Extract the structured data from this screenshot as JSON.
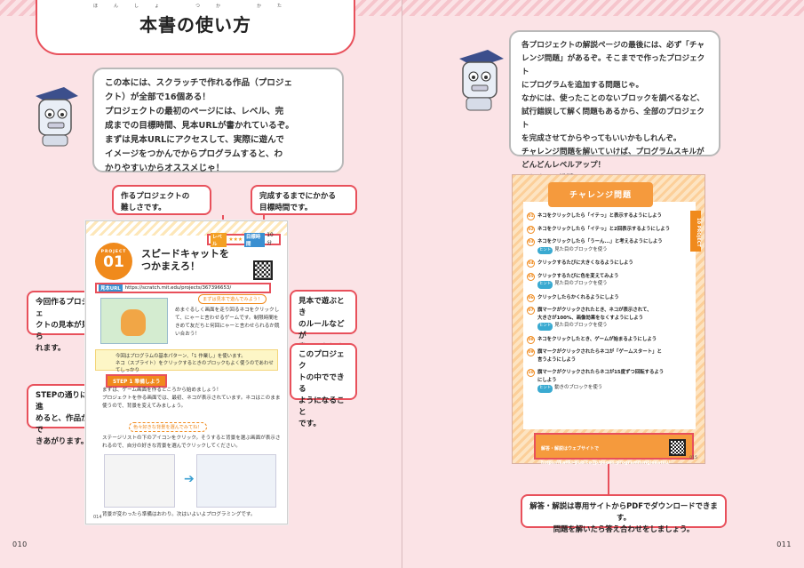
{
  "left_page": {
    "title": "本書の使い方",
    "title_ruby": "ほんしょ　つか　かた",
    "intro_bubble": "この本には、スクラッチで作れる作品（プロジェ\nクト）が全部で16個ある！\nプロジェクトの最初のページには、レベル、完\n成までの目標時間、見本URLが書かれているぞ。\nまずは見本URLにアクセスして、実際に遊んで\nイメージをつかんでからプログラムすると、わ\nかりやすいからオススメじゃ！",
    "callout_difficulty": "作るプロジェクトの\n難しさです。",
    "callout_time": "完成するまでにかかる\n目標時間です。",
    "callout_sample": "今回作るプロジェ\nクトの見本が見ら\nれます。",
    "callout_rules": "見本で遊ぶとき\nのルールなどが\n書いてあります。",
    "callout_inside": "このプロジェク\nトの中でできる\nようになること\nです。",
    "callout_steps": "STEPの通りに進\nめると、作品がで\nきあがります。",
    "page_number": "010",
    "sample": {
      "level_label": "レベル",
      "level_stars": "★★★",
      "time_label": "目標時間",
      "time_value": "10分",
      "project_label": "PROJECT",
      "project_number": "01",
      "project_title": "スピードキャットを\nつかまえろ！",
      "url_label": "見本URL",
      "url": "https://scratch.mit.edu/projects/367396653/",
      "play_pill": "まずは見本で遊んでみよう！",
      "play_text": "めまぐるしく画面を走り回るネコをクリックし\nて、にゃーと言わせるゲームです。制限時間を\nきめて友だちと何回にゃーと言わせられるか競\nい合おう！",
      "note_text": "今回はプログラムの基本パターン、「1 作業し」を使います。\nネコ（スプライト）をクリックするときのブロックもよく使うのであわせてしっかり\n覚えましょう。",
      "step_label": "STEP 1  準備しよう",
      "step_text": "まずは、ゲーム画面を作るところから始めましょう！\nプロジェクトを作る画面では、最初、ネコが表示されています。ネコはこのまま\n使うので、背景を変えてみましょう。",
      "tip_text": "色々好きな背景を選んでみてね！",
      "stage_text": "ステージリストの下のアイコンをクリック。そうすると背景を選ぶ画面が表示さ\nれるので、自分の好きな背景を選んでクリックしてください。",
      "after_text": "背景が変わったら準備はおわり。次はいよいよプログラミングです。",
      "page_number": "014"
    }
  },
  "right_page": {
    "intro_bubble": "各プロジェクトの解説ページの最後には、必ず「チャ\nレンジ問題」があるぞ。そこまでで作ったプロジェクト\nにプログラムを追加する問題じゃ。\nなかには、使ったことのないブロックを調べるなど、\n試行錯誤して解く問題もあるから、全部のプロジェクト\nを完成させてからやってもいいかもしれんぞ。\nチャレンジ問題を解いていけば、プログラムスキルが\nどんどんレベルアップ！\nはりきって挑戦していくのじゃ！",
    "challenge": {
      "banner": "チャレンジ問題",
      "side_tab": "10 PROJECT",
      "items": [
        {
          "num": "01",
          "text": "ネコをクリックしたら「イテっ」と表示するようにしよう",
          "hint": ""
        },
        {
          "num": "02",
          "text": "ネコをクリックしたら「イテっ」と2回表示するようにしよう",
          "hint": ""
        },
        {
          "num": "03",
          "text": "ネコをクリックしたら「うーん...」と考えるようにしよう",
          "hint": "見た目のブロックを使う"
        },
        {
          "num": "04",
          "text": "クリックするたびに大きくなるようにしよう",
          "hint": ""
        },
        {
          "num": "05",
          "text": "クリックするたびに色を変えてみよう",
          "hint": "見た目のブロックを使う"
        },
        {
          "num": "06",
          "text": "クリックしたらかくれるようにしよう",
          "hint": ""
        },
        {
          "num": "07",
          "text": "旗マークがクリックされたとき、ネコが表示されて、\n大きさが100%、画像効果をなくすようにしよう",
          "hint": "見た目のブロックを使う"
        },
        {
          "num": "08",
          "text": "ネコをクリックしたとき、ゲームが始まるようにしよう",
          "hint": ""
        },
        {
          "num": "09",
          "text": "旗マークがクリックされたらネコが「ゲームスタート」と\n言うようにしよう",
          "hint": ""
        },
        {
          "num": "10",
          "text": "旗マークがクリックされたらネコが15度ずつ回転するよう\nにしよう",
          "hint": "動きのブロックを使う"
        }
      ],
      "answer_label": "解答・解説はウェブサイトで",
      "answer_url": "https://kanki-pub.co.jp/pages/programmingisaatsu/",
      "page_number": "015"
    },
    "callout_download": "解答・解説は専用サイトからPDFでダウンロードできます。\n問題を解いたら答え合わせをしましょう。",
    "page_number": "011"
  },
  "colors": {
    "accent_red": "#e8505b",
    "orange": "#f08a1c",
    "page_pink": "#fbe3e6"
  }
}
